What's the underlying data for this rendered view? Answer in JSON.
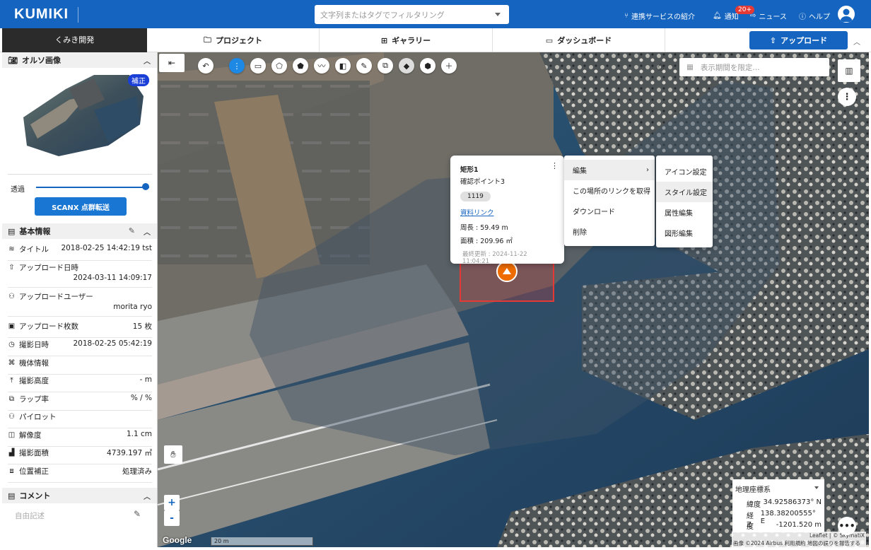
{
  "header": {
    "logo": "KUMIKI",
    "search_placeholder": "文字列またはタグでフィルタリング",
    "links": {
      "partner": "連携サービスの紹介",
      "notify": "通知",
      "notify_badge": "20+",
      "news": "ニュース",
      "help": "ヘルプ"
    }
  },
  "subnav": {
    "org": "くみき開発",
    "tabs": [
      "プロジェクト",
      "ギャラリー",
      "ダッシュボード"
    ],
    "upload": "アップロード"
  },
  "left": {
    "ortho": {
      "title": "オルソ画像",
      "badge": "補正",
      "transparency_label": "透過",
      "transparency_value": 1.0,
      "scanx_button": "SCANX 点群転送"
    },
    "basic": {
      "title": "基本情報",
      "rows": [
        {
          "label": "タイトル",
          "value": "2018-02-25 14:42:19 tst",
          "icon": "layers-icon"
        },
        {
          "label": "アップロード日時",
          "value": "2024-03-11 14:09:17",
          "icon": "upload-icon"
        },
        {
          "label": "アップロードユーザー",
          "value": "morita ryo",
          "icon": "user-icon"
        },
        {
          "label": "アップロード枚数",
          "value": "15 枚",
          "icon": "images-icon"
        },
        {
          "label": "撮影日時",
          "value": "2018-02-25 05:42:19",
          "icon": "clock-icon"
        },
        {
          "label": "機体情報",
          "value": "",
          "icon": "drone-icon"
        },
        {
          "label": "撮影高度",
          "value": "- m",
          "icon": "altitude-icon"
        },
        {
          "label": "ラップ率",
          "value": "% / %",
          "icon": "overlap-icon"
        },
        {
          "label": "パイロット",
          "value": "",
          "icon": "pilot-icon"
        },
        {
          "label": "解像度",
          "value": "1.1 cm",
          "icon": "resolution-icon"
        },
        {
          "label": "撮影面積",
          "value": "4739.197 ㎡",
          "icon": "area-icon"
        },
        {
          "label": "位置補正",
          "value": "処理済み",
          "icon": "position-icon"
        }
      ]
    },
    "comment": {
      "title": "コメント",
      "placeholder": "自由記述"
    }
  },
  "map": {
    "date_placeholder": "表示期間を限定...",
    "popup": {
      "title": "矩形1",
      "subtitle": "確認ポイント3",
      "chip": "1119",
      "link": "資料リンク",
      "perimeter": "周長 : 59.49 m",
      "area": "面積 : 209.96 ㎡",
      "updated": "最終更新 : 2024-11-22 11:04:21"
    },
    "context_menu": [
      "編集",
      "この場所のリンクを取得",
      "ダウンロード",
      "削除"
    ],
    "submenu": [
      "アイコン設定",
      "スタイル設定",
      "属性編集",
      "図形編集"
    ],
    "coords": {
      "system": "地理座標系",
      "lat_label": "緯度",
      "lat": "34.92586373° N",
      "lon_label": "経度",
      "lon": "138.38200555° E",
      "z_label": "Z",
      "z": "-1201.520 m"
    },
    "zoom_in": "+",
    "zoom_out": "-",
    "google": "Google",
    "scale": "20 m",
    "attribution_top": "Leaflet | © SkymatiX",
    "attribution_bottom": "画像 ©2024 Airbus  利用規約  地図の誤りを報告する"
  }
}
